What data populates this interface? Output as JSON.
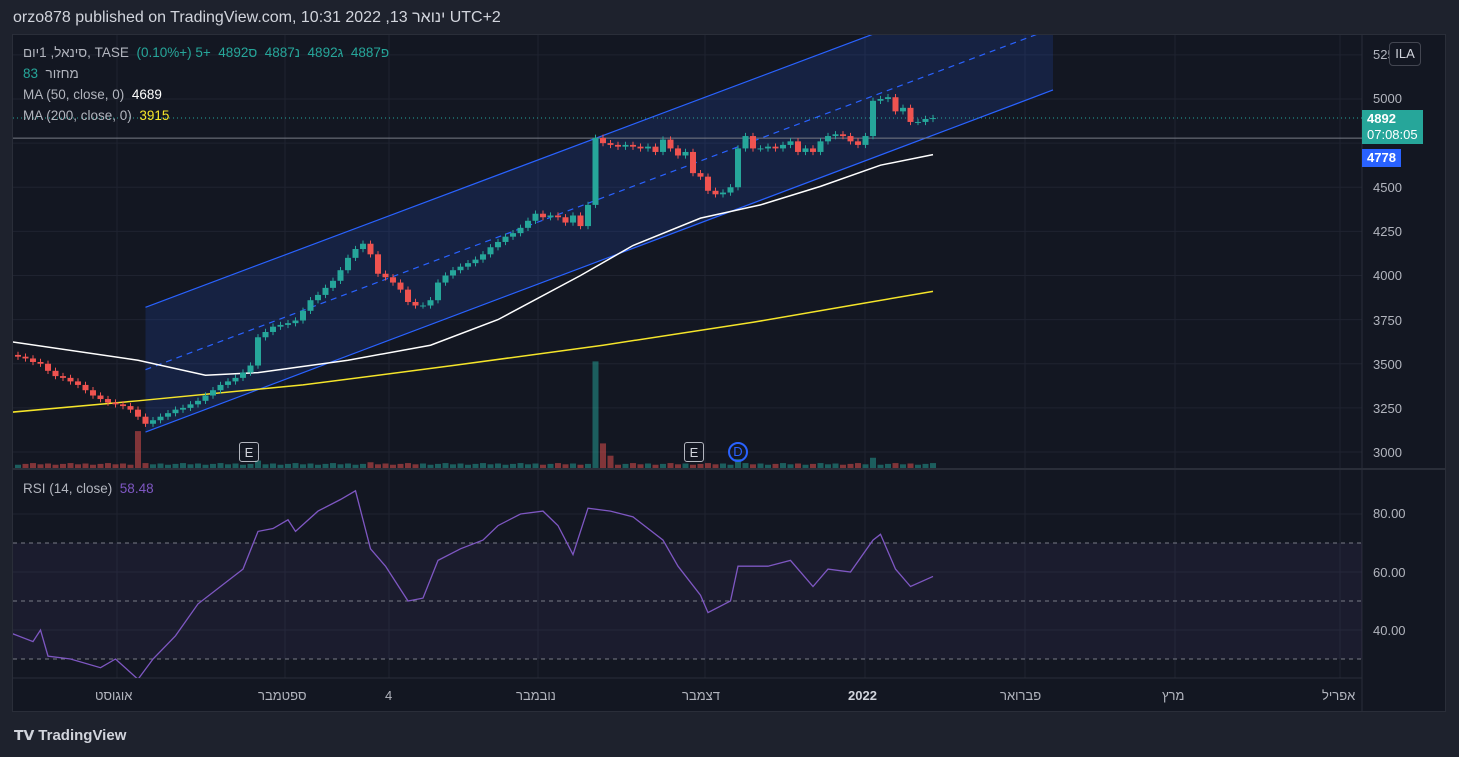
{
  "header": {
    "title": "orzo878 published on TradingView.com, 10:31 2022 ,13 ינואר UTC+2"
  },
  "legend": {
    "symbol": "סינאל, 1יום, TASE",
    "open": "פ4887",
    "high": "ג4892",
    "low": "נ4887",
    "close": "ס4892",
    "change": "+5 (+0.10%)",
    "volume_label": "מחזור",
    "volume_value": "83",
    "ma50_label": "MA (50, close, 0)",
    "ma50_value": "4689",
    "ma200_label": "MA (200, close, 0)",
    "ma200_value": "3915",
    "rsi_label": "RSI (14, close)",
    "rsi_value": "58.48"
  },
  "currency_button": "ILA",
  "price_tag": {
    "price": "4892",
    "countdown": "07:08:05"
  },
  "line_tag": "4778",
  "price_axis": [
    "5250",
    "5000",
    "4500",
    "4250",
    "4000",
    "3750",
    "3500",
    "3250",
    "3000"
  ],
  "rsi_axis": [
    "80.00",
    "60.00",
    "40.00"
  ],
  "time_axis": [
    "אוגוסט",
    "ספטמבר",
    "4",
    "נובמבר",
    "דצמבר",
    "2022",
    "פברואר",
    "מרץ",
    "אפריל"
  ],
  "markers": [
    "E",
    "E",
    "D"
  ],
  "footer": {
    "brand": "TradingView"
  },
  "colors": {
    "up": "#26a69a",
    "down": "#ef5350",
    "ma50": "#ffffff",
    "ma200": "#f5e52a",
    "rsi": "#7e57c2",
    "channel": "#2962ff"
  },
  "chart_data": {
    "type": "candlestick",
    "closes": [
      3540,
      3530,
      3510,
      3500,
      3460,
      3430,
      3420,
      3400,
      3380,
      3350,
      3320,
      3300,
      3280,
      3270,
      3260,
      3240,
      3200,
      3160,
      3180,
      3200,
      3220,
      3240,
      3250,
      3270,
      3290,
      3320,
      3350,
      3380,
      3400,
      3420,
      3450,
      3490,
      3650,
      3680,
      3710,
      3720,
      3730,
      3745,
      3800,
      3860,
      3890,
      3930,
      3970,
      4030,
      4100,
      4150,
      4180,
      4120,
      4010,
      3990,
      3960,
      3920,
      3850,
      3830,
      3830,
      3860,
      3960,
      4000,
      4030,
      4050,
      4070,
      4090,
      4120,
      4160,
      4190,
      4220,
      4240,
      4270,
      4310,
      4350,
      4330,
      4340,
      4330,
      4300,
      4340,
      4280,
      4400,
      4780,
      4750,
      4740,
      4730,
      4740,
      4730,
      4720,
      4730,
      4700,
      4770,
      4720,
      4680,
      4700,
      4580,
      4560,
      4480,
      4460,
      4470,
      4500,
      4720,
      4790,
      4720,
      4720,
      4730,
      4720,
      4740,
      4760,
      4700,
      4720,
      4700,
      4760,
      4790,
      4800,
      4790,
      4760,
      4740,
      4790,
      4990,
      5000,
      5010,
      4930,
      4950,
      4870,
      4870,
      4887,
      4892
    ],
    "volume_base": 8,
    "volume_spikes": {
      "16": 90,
      "32": 18,
      "47": 14,
      "77": 260,
      "78": 60,
      "79": 30,
      "96": 22,
      "114": 25
    },
    "ma50": [
      [
        -1,
        3625
      ],
      [
        16,
        3520
      ],
      [
        25,
        3435
      ],
      [
        32,
        3450
      ],
      [
        44,
        3520
      ],
      [
        55,
        3605
      ],
      [
        64,
        3750
      ],
      [
        75,
        4000
      ],
      [
        82,
        4170
      ],
      [
        91,
        4325
      ],
      [
        99,
        4400
      ],
      [
        107,
        4505
      ],
      [
        115,
        4625
      ],
      [
        122,
        4685
      ]
    ],
    "ma200": [
      [
        -1,
        3225
      ],
      [
        16,
        3290
      ],
      [
        38,
        3380
      ],
      [
        58,
        3490
      ],
      [
        78,
        3605
      ],
      [
        98,
        3735
      ],
      [
        111,
        3830
      ],
      [
        122,
        3910
      ]
    ],
    "rsi": [
      [
        -1,
        39
      ],
      [
        2,
        36
      ],
      [
        3,
        40
      ],
      [
        4,
        31
      ],
      [
        7,
        30
      ],
      [
        11,
        27
      ],
      [
        13,
        30
      ],
      [
        16,
        23
      ],
      [
        18,
        30
      ],
      [
        21,
        38
      ],
      [
        24,
        49
      ],
      [
        27,
        55
      ],
      [
        30,
        61
      ],
      [
        32,
        74
      ],
      [
        34,
        75
      ],
      [
        36,
        78
      ],
      [
        37,
        74
      ],
      [
        40,
        81
      ],
      [
        43,
        85
      ],
      [
        45,
        88
      ],
      [
        47,
        68
      ],
      [
        49,
        62
      ],
      [
        52,
        50
      ],
      [
        54,
        51
      ],
      [
        56,
        64
      ],
      [
        59,
        68
      ],
      [
        62,
        71
      ],
      [
        64,
        76
      ],
      [
        67,
        80
      ],
      [
        70,
        81
      ],
      [
        72,
        76
      ],
      [
        74,
        66
      ],
      [
        76,
        82
      ],
      [
        79,
        81
      ],
      [
        82,
        79
      ],
      [
        86,
        71
      ],
      [
        88,
        62
      ],
      [
        91,
        52
      ],
      [
        92,
        46
      ],
      [
        95,
        50
      ],
      [
        96,
        62
      ],
      [
        100,
        62
      ],
      [
        103,
        64
      ],
      [
        106,
        55
      ],
      [
        108,
        61
      ],
      [
        111,
        60
      ],
      [
        114,
        71
      ],
      [
        115,
        73
      ],
      [
        117,
        61
      ],
      [
        119,
        55
      ],
      [
        122,
        58.48
      ]
    ],
    "channel": {
      "upper": [
        [
          17,
          3820
        ],
        [
          138,
          5750
        ]
      ],
      "lower": [
        [
          17,
          3113
        ],
        [
          138,
          5051
        ]
      ]
    },
    "hline": 4778,
    "last_price": 4892,
    "price_range": [
      2960,
      5350
    ],
    "rsi_range": [
      23,
      90
    ],
    "rsi_levels": [
      70,
      50,
      30
    ]
  }
}
